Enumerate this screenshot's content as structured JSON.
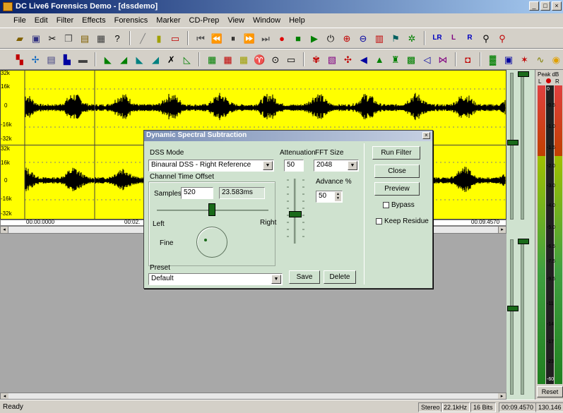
{
  "window": {
    "title": "DC Live6 Forensics Demo - [dssdemo]",
    "min_glyph": "_",
    "max_glyph": "□",
    "close_glyph": "×"
  },
  "menu": [
    "File",
    "Edit",
    "Filter",
    "Effects",
    "Forensics",
    "Marker",
    "CD-Prep",
    "View",
    "Window",
    "Help"
  ],
  "waveform": {
    "y_labels_top": [
      "32k",
      "16k",
      "0",
      "-16k",
      "-32k"
    ],
    "y_labels_bottom": [
      "32k",
      "16k",
      "0",
      "-16k",
      "-32k"
    ],
    "time_start": "00.00.0000",
    "time_mid": "00:02.",
    "time_end": "00.09.4570"
  },
  "dialog": {
    "title": "Dynamic Spectral Subtraction",
    "close_glyph": "×",
    "dss_mode_label": "DSS Mode",
    "dss_mode_value": "Binaural DSS - Right Reference",
    "attenuation_label": "Attenuation",
    "attenuation_value": "50",
    "fft_label": "FFT Size",
    "fft_value": "2048",
    "channel_offset_label": "Channel Time Offset",
    "samples_label": "Samples",
    "samples_value": "520",
    "ms_value": "23.583ms",
    "left_label": "Left",
    "right_label": "Right",
    "fine_label": "Fine",
    "advance_label": "Advance %",
    "advance_value": "50",
    "preset_label": "Preset",
    "preset_value": "Default",
    "run_filter": "Run Filter",
    "close": "Close",
    "preview": "Preview",
    "bypass": "Bypass",
    "keep_residue": "Keep Residue",
    "save": "Save",
    "delete": "Delete"
  },
  "meter": {
    "title": "Peak dB",
    "l": "L",
    "r": "R",
    "scale": [
      "0",
      "-0.5",
      "-1.0",
      "-1.5",
      "-2.0",
      "-2.5",
      "-3.0",
      "-3.5",
      "-4.0",
      "-5.0",
      "-6.5",
      "-7.5",
      "-9.5",
      "-11",
      "-14",
      "-17",
      "-23",
      "-60"
    ],
    "reset": "Reset"
  },
  "status": {
    "ready": "Ready",
    "channels": "Stereo",
    "rate": "22.1kHz",
    "bits": "16 Bits",
    "position": "00:09.4570",
    "extra": "130.146"
  }
}
